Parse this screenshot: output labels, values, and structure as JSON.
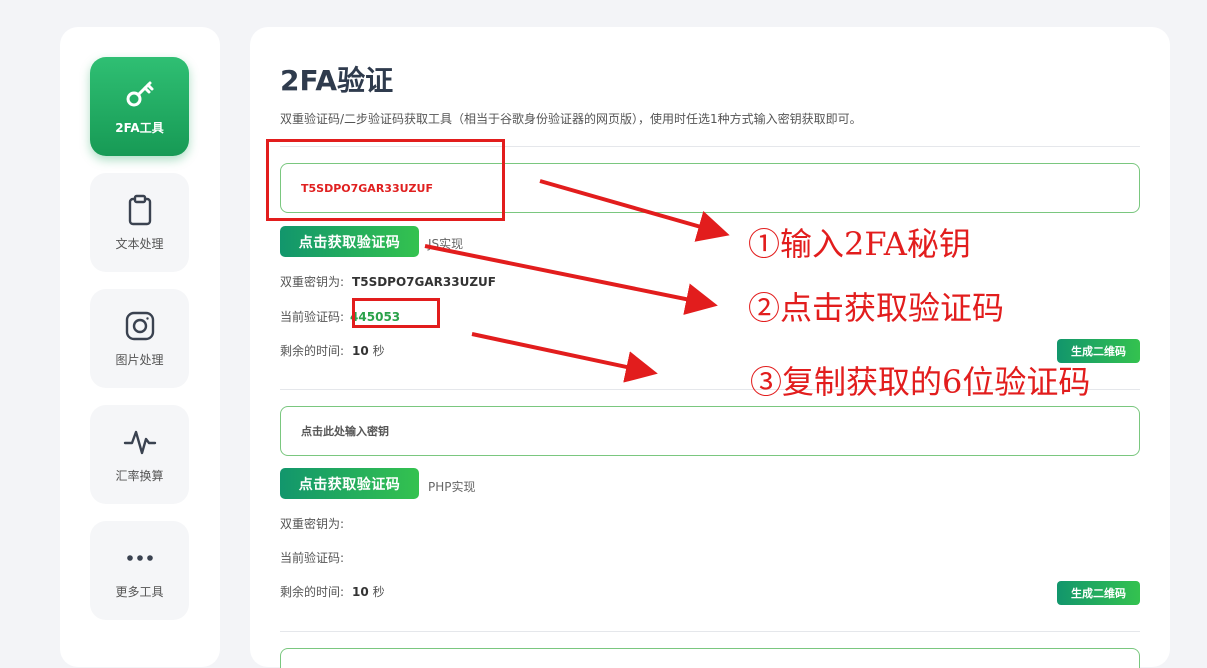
{
  "sidebar": {
    "items": [
      {
        "label": "2FA工具",
        "icon": "key-icon",
        "active": true
      },
      {
        "label": "文本处理",
        "icon": "clipboard-icon",
        "active": false
      },
      {
        "label": "图片处理",
        "icon": "instagram-icon",
        "active": false
      },
      {
        "label": "汇率换算",
        "icon": "pulse-icon",
        "active": false
      },
      {
        "label": "更多工具",
        "icon": "more-icon",
        "active": false
      }
    ]
  },
  "main": {
    "title": "2FA验证",
    "subtitle": "双重验证码/二步验证码获取工具（相当于谷歌身份验证器的网页版），使用时任选1种方式输入密钥获取即可。",
    "sections": [
      {
        "input_value": "T5SDPO7GAR33UZUF",
        "input_placeholder": "",
        "button_label": "点击获取验证码",
        "impl_label": "JS实现",
        "secret_label": "双重密钥为:",
        "secret_value": "T5SDPO7GAR33UZUF",
        "code_label": "当前验证码:",
        "code_value": "445053",
        "time_label": "剩余的时间:",
        "time_value": "10",
        "time_unit": "秒",
        "qr_button_label": "生成二维码"
      },
      {
        "input_value": "",
        "input_placeholder": "点击此处输入密钥",
        "button_label": "点击获取验证码",
        "impl_label": "PHP实现",
        "secret_label": "双重密钥为:",
        "secret_value": "",
        "code_label": "当前验证码:",
        "code_value": "",
        "time_label": "剩余的时间:",
        "time_value": "10",
        "time_unit": "秒",
        "qr_button_label": "生成二维码"
      }
    ]
  },
  "annotations": {
    "step1": "①输入2FA秘钥",
    "step2": "②点击获取验证码",
    "step3": "③复制获取的6位验证码"
  },
  "colors": {
    "accent_green": "#1fa25e",
    "annotation_red": "#e21d1d",
    "code_green": "#2aa24a"
  }
}
